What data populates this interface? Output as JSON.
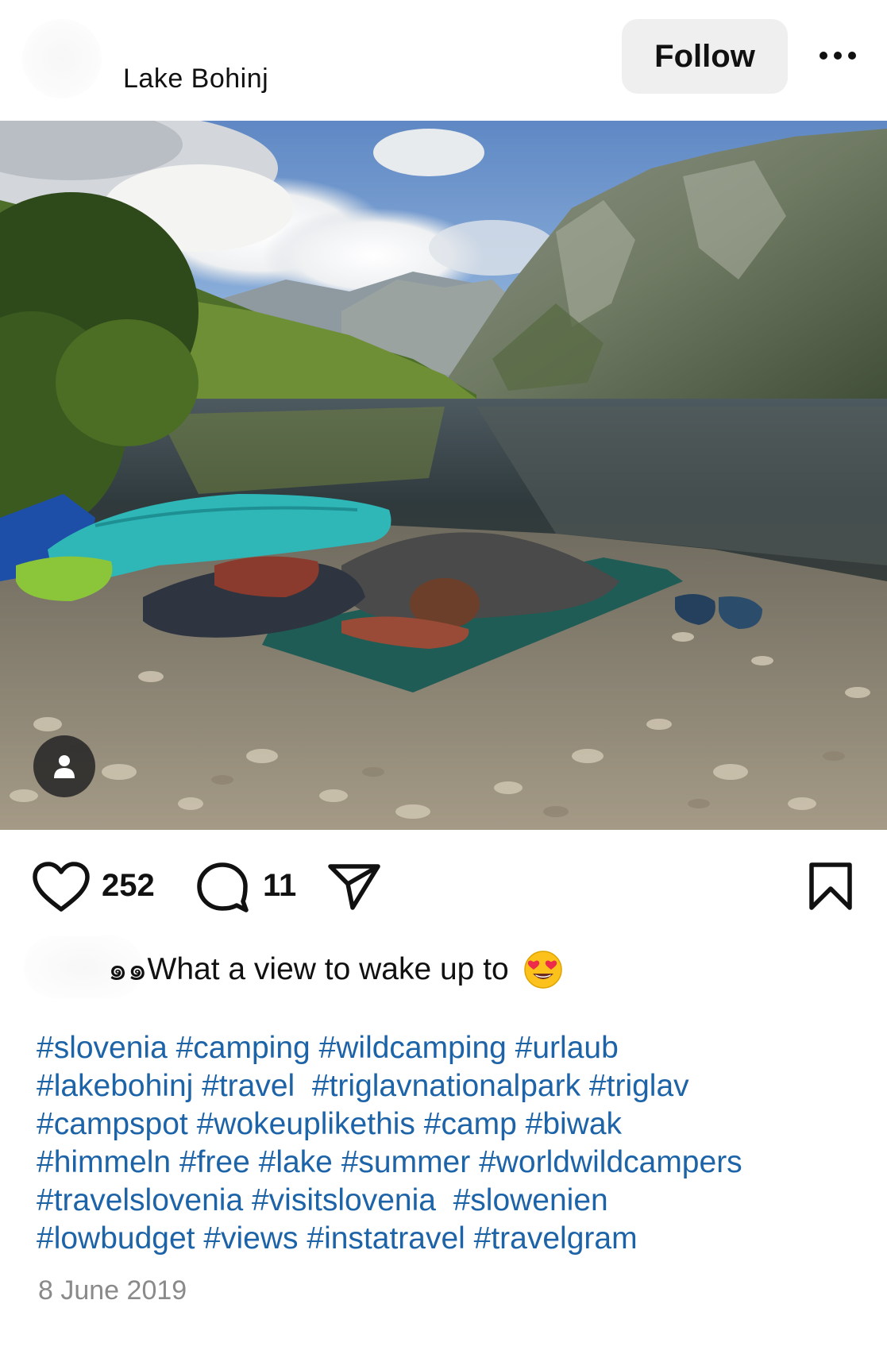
{
  "header": {
    "account_name": "Lake Bohinj",
    "follow_label": "Follow",
    "more_icon": "more-horizontal-icon"
  },
  "photo": {
    "tag_icon": "person-icon"
  },
  "actions": {
    "like_count": "252",
    "comment_count": "11",
    "like_icon": "heart-icon",
    "comment_icon": "comment-bubble-icon",
    "share_icon": "paper-plane-icon",
    "save_icon": "bookmark-icon"
  },
  "caption": {
    "prefix": "๑๑",
    "text": "What a view to wake up to",
    "emoji": "heart-eyes-emoji"
  },
  "hashtags": {
    "lines": [
      "#slovenia #camping #wildcamping #urlaub",
      "#lakebohinj #travel  #triglavnationalpark #triglav",
      "#campspot #wokeuplikethis #camp #biwak",
      "#himmeln #free #lake #summer #worldwildcampers",
      "#travelslovenia #visitslovenia  #slowenien",
      "#lowbudget #views #instatravel #travelgram"
    ]
  },
  "post_date": "8 June 2019",
  "colors": {
    "link": "#1d63a8",
    "button_bg": "#efefef",
    "muted": "#8a8a8a"
  }
}
